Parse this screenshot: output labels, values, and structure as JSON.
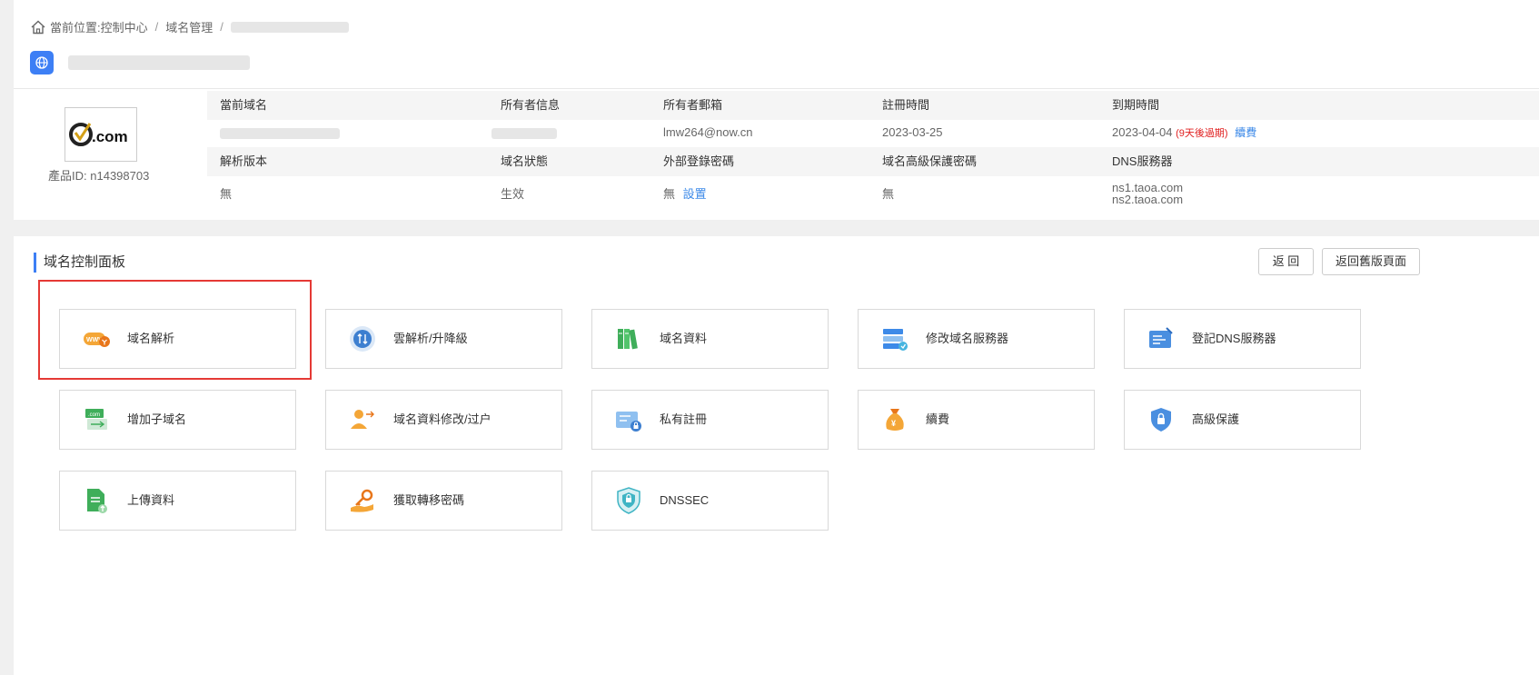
{
  "breadcrumb": {
    "prefix": "當前位置:",
    "items": [
      "控制中心",
      "域名管理"
    ],
    "separator": "/"
  },
  "product": {
    "logo_text": ".com",
    "id_label": "產品ID:",
    "id_value": "n14398703"
  },
  "info_table": {
    "row1_headers": [
      "當前域名",
      "所有者信息",
      "所有者郵箱",
      "註冊時間",
      "到期時間"
    ],
    "row1_values": {
      "owner_email": "lmw264@now.cn",
      "reg_date": "2023-03-25",
      "expire_date": "2023-04-04",
      "expire_note": "(9天後過期)",
      "renew_link": "續費"
    },
    "row2_headers": [
      "解析版本",
      "域名狀態",
      "外部登錄密碼",
      "域名高級保護密碼",
      "DNS服務器"
    ],
    "row2_values": {
      "dns_version": "無",
      "status": "生效",
      "ext_pwd": "無",
      "ext_pwd_link": "設置",
      "adv_pwd": "無",
      "dns1": "ns1.taoa.com",
      "dns2": "ns2.taoa.com"
    }
  },
  "panel": {
    "title": "域名控制面板",
    "back_button": "返 回",
    "old_page_button": "返回舊版頁面"
  },
  "cards": [
    {
      "label": "域名解析",
      "icon": "www-dns-icon"
    },
    {
      "label": "雲解析/升降級",
      "icon": "cloud-updown-icon"
    },
    {
      "label": "域名資料",
      "icon": "books-icon"
    },
    {
      "label": "修改域名服務器",
      "icon": "server-edit-icon"
    },
    {
      "label": "登記DNS服務器",
      "icon": "dns-register-icon"
    },
    {
      "label": "增加子域名",
      "icon": "subdomain-icon"
    },
    {
      "label": "域名資料修改/过户",
      "icon": "user-transfer-icon"
    },
    {
      "label": "私有註冊",
      "icon": "private-lock-icon"
    },
    {
      "label": "續費",
      "icon": "money-bag-icon"
    },
    {
      "label": "高級保護",
      "icon": "shield-lock-icon"
    },
    {
      "label": "上傳資料",
      "icon": "upload-doc-icon"
    },
    {
      "label": "獲取轉移密碼",
      "icon": "key-hand-icon"
    },
    {
      "label": "DNSSEC",
      "icon": "dnssec-shield-icon"
    }
  ],
  "colors": {
    "accent": "#3d7ff5",
    "link": "#3d8ae8",
    "active_green": "#52b44c",
    "warning_red": "#e02020",
    "highlight_red": "#e53935"
  }
}
